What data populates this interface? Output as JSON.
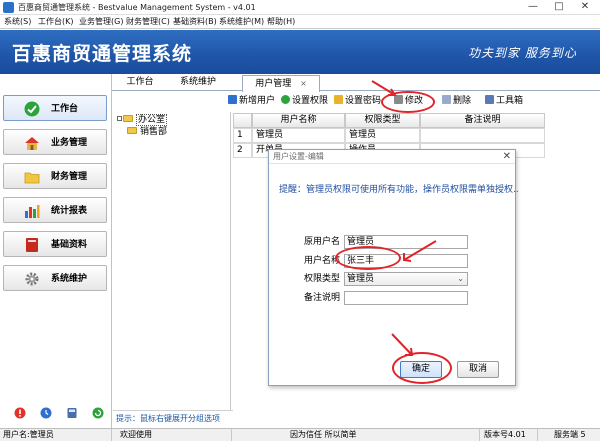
{
  "window": {
    "title": "百惠商贸通管理系统 - Bestvalue Management System - v4.01",
    "min_glyph": "—",
    "max_glyph": "□",
    "close_glyph": "✕"
  },
  "menubar": [
    "系统(S)",
    "工作台(K)",
    "业务管理(G)",
    "财务管理(C)",
    "基础资料(B)",
    "系统维护(M)",
    "帮助(H)"
  ],
  "banner": {
    "title": "百惠商贸通管理系统",
    "slogan": "功夫到家 服务到心"
  },
  "sidebar": {
    "items": [
      {
        "label": "工作台",
        "icon": "check-circle-icon",
        "active": true
      },
      {
        "label": "业务管理",
        "icon": "house-icon",
        "active": false
      },
      {
        "label": "财务管理",
        "icon": "folder-icon",
        "active": false
      },
      {
        "label": "统计报表",
        "icon": "bar-chart-icon",
        "active": false
      },
      {
        "label": "基础资料",
        "icon": "book-icon",
        "active": false
      },
      {
        "label": "系统维护",
        "icon": "gear-icon",
        "active": false
      }
    ]
  },
  "tabs": [
    {
      "label": "工作台"
    },
    {
      "label": "系统维护"
    },
    {
      "label": "用户管理",
      "closable": true
    }
  ],
  "tab_close_glyph": "×",
  "toolbar": {
    "add_user": "新增用户",
    "set_permission": "设置权限",
    "set_password": "设置密码",
    "edit": "修改",
    "delete": "删除",
    "toolbox": "工具箱"
  },
  "tree": {
    "nodes": [
      "办公室",
      "销售部"
    ]
  },
  "tree_tip": "提示：鼠标右键展开分组选项",
  "grid": {
    "columns": [
      "用户名称",
      "权限类型",
      "备注说明"
    ],
    "rows": [
      {
        "no": "1",
        "name": "管理员",
        "type": "管理员",
        "note": ""
      },
      {
        "no": "2",
        "name": "开单员",
        "type": "操作员",
        "note": ""
      }
    ]
  },
  "dialog": {
    "title": "用户设置-编辑",
    "close_glyph": "✕",
    "tip": "提醒：管理员权限可使用所有功能，操作员权限需单独授权..",
    "fields": {
      "orig_name_label": "原用户名",
      "orig_name_value": "管理员",
      "name_label": "用户名称",
      "name_value": "张三丰",
      "type_label": "权限类型",
      "type_value": "管理员",
      "note_label": "备注说明",
      "note_value": ""
    },
    "ok_label": "确定",
    "cancel_label": "取消"
  },
  "statusbar": {
    "user": "用户名:管理员",
    "welcome": "欢迎使用",
    "motto": "因为信任 所以简单",
    "version": "版本号4.01",
    "service": "服务端 5"
  },
  "colors": {
    "banner": "#1f55a8",
    "accent_red": "#e0242a",
    "tip_blue": "#1a56a6"
  }
}
